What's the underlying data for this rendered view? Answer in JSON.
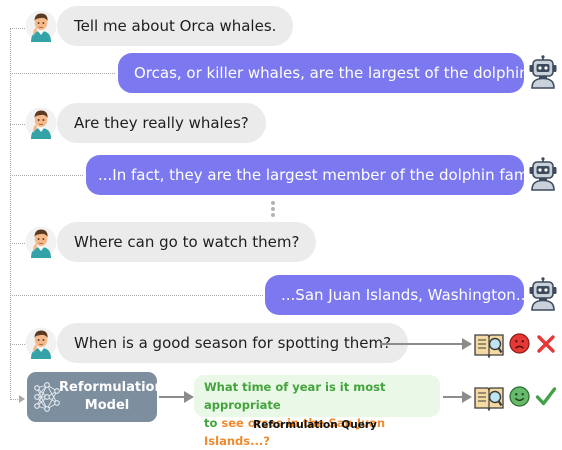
{
  "conversation": [
    {
      "role": "user",
      "text": "Tell me about Orca whales."
    },
    {
      "role": "bot",
      "text": "Orcas, or killer whales, are the largest of the dolphins..."
    },
    {
      "role": "user",
      "text": "Are they really whales?"
    },
    {
      "role": "bot",
      "text": "...In fact, they are the largest member of the dolphin family!"
    },
    {
      "role": "user",
      "text": "Where can go to watch them?"
    },
    {
      "role": "bot",
      "text": "...San Juan Islands, Washington..."
    },
    {
      "role": "user",
      "text": "When is a good season for spotting them?"
    }
  ],
  "reformulation": {
    "model_line1": "Reformulation",
    "model_line2": "Model",
    "query_part1": "What time of year is it most appropriate",
    "query_part2": "to ",
    "query_highlight": "see orcas in the San Juan Islands...?",
    "caption": "Reformulation Query"
  },
  "colors": {
    "user_bubble": "#ebebeb",
    "bot_bubble": "#7c79f0",
    "model_box": "#7d8e9e",
    "query_bg": "#eaf8e8",
    "query_text": "#43a33c",
    "query_highlight": "#ef8a2e",
    "fail_x": "#e53935",
    "success_check": "#43a047"
  },
  "icons": {
    "user": "person-avatar-icon",
    "bot": "robot-icon",
    "search": "book-search-icon",
    "sad": "sad-face-icon",
    "happy": "happy-face-icon",
    "fail": "x-mark-icon",
    "success": "check-mark-icon",
    "network": "neural-network-icon"
  }
}
